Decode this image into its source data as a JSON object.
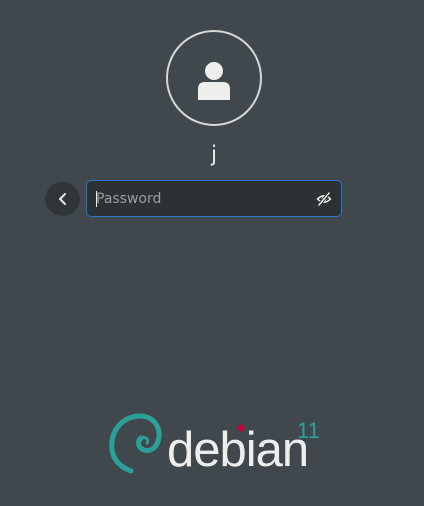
{
  "user": {
    "name": "j",
    "avatar_icon": "user-icon"
  },
  "password_field": {
    "placeholder": "Password",
    "value": "",
    "reveal_icon": "eye-slash-icon",
    "focus_color": "#2e73c8"
  },
  "back_button": {
    "icon": "chevron-left-icon"
  },
  "branding": {
    "wordmark": "debian",
    "version": "11",
    "swirl_color": "#2aa198",
    "dot_color": "#c7003b"
  },
  "colors": {
    "background": "#41484d",
    "text": "#eeeeec"
  }
}
